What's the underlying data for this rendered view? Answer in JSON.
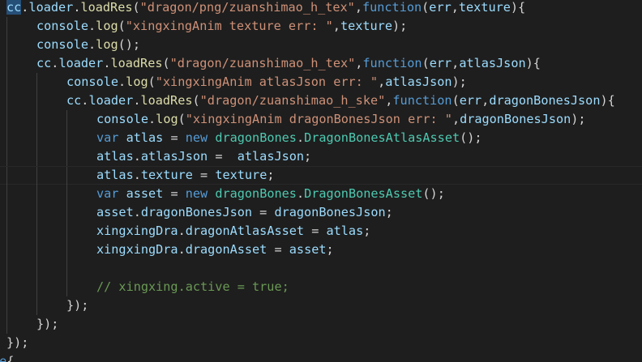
{
  "editor": {
    "lines": [
      {
        "indent": 0,
        "tokens": [
          {
            "t": "cc",
            "c": "id",
            "sel": true
          },
          {
            "t": ".",
            "c": "pun"
          },
          {
            "t": "loader",
            "c": "id"
          },
          {
            "t": ".",
            "c": "pun"
          },
          {
            "t": "loadRes",
            "c": "fn"
          },
          {
            "t": "(",
            "c": "pun"
          },
          {
            "t": "\"dragon/png/zuanshimao_h_tex\"",
            "c": "str"
          },
          {
            "t": ",",
            "c": "pun"
          },
          {
            "t": "function",
            "c": "kw"
          },
          {
            "t": "(",
            "c": "pun"
          },
          {
            "t": "err",
            "c": "id"
          },
          {
            "t": ",",
            "c": "pun"
          },
          {
            "t": "texture",
            "c": "id"
          },
          {
            "t": "){",
            "c": "pun"
          }
        ]
      },
      {
        "indent": 1,
        "tokens": [
          {
            "t": "console",
            "c": "id"
          },
          {
            "t": ".",
            "c": "pun"
          },
          {
            "t": "log",
            "c": "fn"
          },
          {
            "t": "(",
            "c": "pun"
          },
          {
            "t": "\"xingxingAnim texture err: \"",
            "c": "str"
          },
          {
            "t": ",",
            "c": "pun"
          },
          {
            "t": "texture",
            "c": "id"
          },
          {
            "t": ");",
            "c": "pun"
          }
        ]
      },
      {
        "indent": 1,
        "tokens": [
          {
            "t": "console",
            "c": "id"
          },
          {
            "t": ".",
            "c": "pun"
          },
          {
            "t": "log",
            "c": "fn"
          },
          {
            "t": "();",
            "c": "pun"
          }
        ]
      },
      {
        "indent": 1,
        "tokens": [
          {
            "t": "cc",
            "c": "id"
          },
          {
            "t": ".",
            "c": "pun"
          },
          {
            "t": "loader",
            "c": "id"
          },
          {
            "t": ".",
            "c": "pun"
          },
          {
            "t": "loadRes",
            "c": "fn"
          },
          {
            "t": "(",
            "c": "pun"
          },
          {
            "t": "\"dragon/zuanshimao_h_tex\"",
            "c": "str"
          },
          {
            "t": ",",
            "c": "pun"
          },
          {
            "t": "function",
            "c": "kw"
          },
          {
            "t": "(",
            "c": "pun"
          },
          {
            "t": "err",
            "c": "id"
          },
          {
            "t": ",",
            "c": "pun"
          },
          {
            "t": "atlasJson",
            "c": "id"
          },
          {
            "t": "){",
            "c": "pun"
          }
        ]
      },
      {
        "indent": 2,
        "tokens": [
          {
            "t": "console",
            "c": "id"
          },
          {
            "t": ".",
            "c": "pun"
          },
          {
            "t": "log",
            "c": "fn"
          },
          {
            "t": "(",
            "c": "pun"
          },
          {
            "t": "\"xingxingAnim atlasJson err: \"",
            "c": "str"
          },
          {
            "t": ",",
            "c": "pun"
          },
          {
            "t": "atlasJson",
            "c": "id"
          },
          {
            "t": ");",
            "c": "pun"
          }
        ]
      },
      {
        "indent": 2,
        "tokens": [
          {
            "t": "cc",
            "c": "id"
          },
          {
            "t": ".",
            "c": "pun"
          },
          {
            "t": "loader",
            "c": "id"
          },
          {
            "t": ".",
            "c": "pun"
          },
          {
            "t": "loadRes",
            "c": "fn"
          },
          {
            "t": "(",
            "c": "pun"
          },
          {
            "t": "\"dragon/zuanshimao_h_ske\"",
            "c": "str"
          },
          {
            "t": ",",
            "c": "pun"
          },
          {
            "t": "function",
            "c": "kw"
          },
          {
            "t": "(",
            "c": "pun"
          },
          {
            "t": "err",
            "c": "id"
          },
          {
            "t": ",",
            "c": "pun"
          },
          {
            "t": "dragonBonesJson",
            "c": "id"
          },
          {
            "t": "){",
            "c": "pun"
          }
        ]
      },
      {
        "indent": 3,
        "tokens": [
          {
            "t": "console",
            "c": "id"
          },
          {
            "t": ".",
            "c": "pun"
          },
          {
            "t": "log",
            "c": "fn"
          },
          {
            "t": "(",
            "c": "pun"
          },
          {
            "t": "\"xingxingAnim dragonBonesJson err: \"",
            "c": "str"
          },
          {
            "t": ",",
            "c": "pun"
          },
          {
            "t": "dragonBonesJson",
            "c": "id"
          },
          {
            "t": ");",
            "c": "pun"
          }
        ]
      },
      {
        "indent": 3,
        "tokens": [
          {
            "t": "var",
            "c": "kw"
          },
          {
            "t": " ",
            "c": "pun"
          },
          {
            "t": "atlas",
            "c": "id"
          },
          {
            "t": " = ",
            "c": "pun"
          },
          {
            "t": "new",
            "c": "kw"
          },
          {
            "t": " ",
            "c": "pun"
          },
          {
            "t": "dragonBones",
            "c": "type"
          },
          {
            "t": ".",
            "c": "pun"
          },
          {
            "t": "DragonBonesAtlasAsset",
            "c": "type"
          },
          {
            "t": "();",
            "c": "pun"
          }
        ]
      },
      {
        "indent": 3,
        "tokens": [
          {
            "t": "atlas",
            "c": "id"
          },
          {
            "t": ".",
            "c": "pun"
          },
          {
            "t": "atlasJson",
            "c": "id"
          },
          {
            "t": " =  ",
            "c": "pun"
          },
          {
            "t": "atlasJson",
            "c": "id"
          },
          {
            "t": ";",
            "c": "pun"
          }
        ]
      },
      {
        "indent": 3,
        "current": true,
        "tokens": [
          {
            "t": "atlas",
            "c": "id"
          },
          {
            "t": ".",
            "c": "pun"
          },
          {
            "t": "texture",
            "c": "id"
          },
          {
            "t": " = ",
            "c": "pun"
          },
          {
            "t": "texture",
            "c": "id"
          },
          {
            "t": ";",
            "c": "pun"
          }
        ]
      },
      {
        "indent": 3,
        "tokens": [
          {
            "t": "var",
            "c": "kw"
          },
          {
            "t": " ",
            "c": "pun"
          },
          {
            "t": "asset",
            "c": "id"
          },
          {
            "t": " = ",
            "c": "pun"
          },
          {
            "t": "new",
            "c": "kw"
          },
          {
            "t": " ",
            "c": "pun"
          },
          {
            "t": "dragonBones",
            "c": "type"
          },
          {
            "t": ".",
            "c": "pun"
          },
          {
            "t": "DragonBonesAsset",
            "c": "type"
          },
          {
            "t": "();",
            "c": "pun"
          }
        ]
      },
      {
        "indent": 3,
        "tokens": [
          {
            "t": "asset",
            "c": "id"
          },
          {
            "t": ".",
            "c": "pun"
          },
          {
            "t": "dragonBonesJson",
            "c": "id"
          },
          {
            "t": " = ",
            "c": "pun"
          },
          {
            "t": "dragonBonesJson",
            "c": "id"
          },
          {
            "t": ";",
            "c": "pun"
          }
        ]
      },
      {
        "indent": 3,
        "tokens": [
          {
            "t": "xingxingDra",
            "c": "id"
          },
          {
            "t": ".",
            "c": "pun"
          },
          {
            "t": "dragonAtlasAsset",
            "c": "id"
          },
          {
            "t": " = ",
            "c": "pun"
          },
          {
            "t": "atlas",
            "c": "id"
          },
          {
            "t": ";",
            "c": "pun"
          }
        ]
      },
      {
        "indent": 3,
        "tokens": [
          {
            "t": "xingxingDra",
            "c": "id"
          },
          {
            "t": ".",
            "c": "pun"
          },
          {
            "t": "dragonAsset",
            "c": "id"
          },
          {
            "t": " = ",
            "c": "pun"
          },
          {
            "t": "asset",
            "c": "id"
          },
          {
            "t": ";",
            "c": "pun"
          }
        ]
      },
      {
        "indent": 3,
        "tokens": []
      },
      {
        "indent": 3,
        "tokens": [
          {
            "t": "// xingxing.active = true;",
            "c": "com"
          }
        ]
      },
      {
        "indent": 2,
        "tokens": [
          {
            "t": "});",
            "c": "pun"
          }
        ]
      },
      {
        "indent": 1,
        "tokens": [
          {
            "t": "});",
            "c": "pun"
          }
        ]
      },
      {
        "indent": 0,
        "tokens": [
          {
            "t": "});",
            "c": "pun"
          }
        ]
      },
      {
        "indent": 0,
        "clipLeft": true,
        "tokens": [
          {
            "t": "se",
            "c": "kw"
          },
          {
            "t": "{",
            "c": "pun"
          }
        ]
      }
    ]
  }
}
